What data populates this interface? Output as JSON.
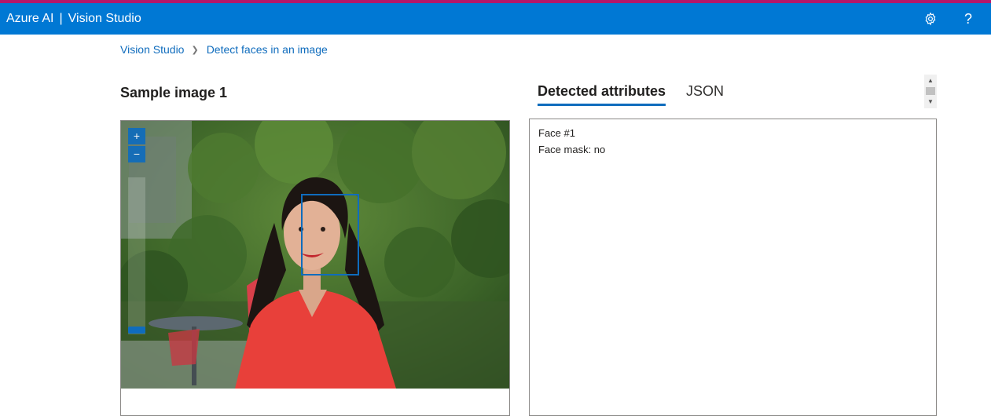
{
  "header": {
    "brand": "Azure AI",
    "separator": "|",
    "product": "Vision Studio",
    "settings_icon": "gear-icon",
    "help_icon": "?"
  },
  "breadcrumb": {
    "items": [
      "Vision Studio",
      "Detect faces in an image"
    ],
    "separator_icon": "chevron-right-icon"
  },
  "sample": {
    "title": "Sample image 1",
    "zoom_in_label": "+",
    "zoom_out_label": "−"
  },
  "results": {
    "tabs": [
      {
        "label": "Detected attributes",
        "active": true
      },
      {
        "label": "JSON",
        "active": false
      }
    ],
    "lines": [
      "Face #1",
      "Face mask: no"
    ]
  },
  "colors": {
    "accent": "#0078d4",
    "top_strip": "#b4176a",
    "face_box": "#0f6cbd"
  }
}
